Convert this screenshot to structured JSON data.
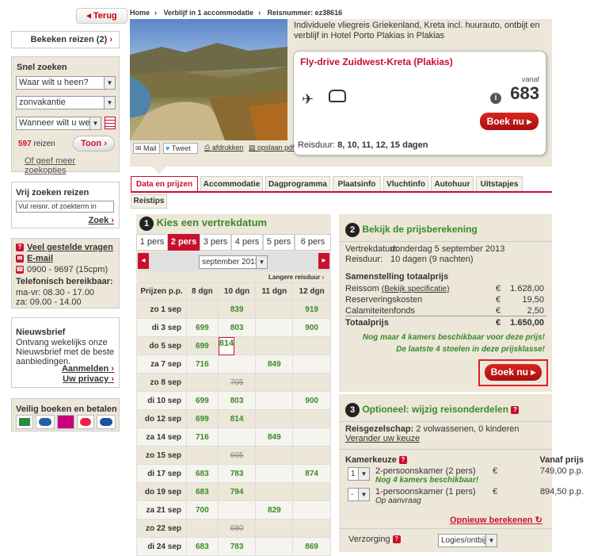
{
  "nav": {
    "back": "Terug"
  },
  "left": {
    "recent": "Bekeken reizen (2)",
    "quick": {
      "title": "Snel zoeken",
      "dest": "Waar wilt u heen?",
      "type": "zonvakantie",
      "when": "Wanneer wilt u weg?",
      "count": "597",
      "count_label": "reizen",
      "show": "Toon",
      "more": "Of geef meer zoekopties"
    },
    "free": {
      "title": "Vrij zoeken reizen",
      "placeholder": "Vul reisnr. of zoekterm in",
      "search": "Zoek"
    },
    "contact": {
      "faq": "Veel gestelde vragen",
      "email": "E-mail",
      "phone": "0900 - 9697 (15cpm)",
      "title": "Telefonisch bereikbaar:",
      "hours1": "ma-vr: 08.30 - 17.00",
      "hours2": "za: 09.00 - 14.00"
    },
    "news": {
      "title": "Nieuwsbrief",
      "text": "Ontvang wekelijks onze Nieuwsbrief met de beste aanbiedingen.",
      "sub": "Aanmelden",
      "privacy": "Uw privacy"
    },
    "safe": {
      "title": "Veilig boeken en betalen"
    }
  },
  "crumb": {
    "home": "Home",
    "stay": "Verblijf in 1 accommodatie",
    "ref": "Reisnummer: ez38616"
  },
  "hero": {
    "desc": "Individuele vliegreis Griekenland, Kreta incl. huurauto, ontbijt en verblijf in Hotel Porto Plakias in Plakias",
    "title": "Fly-drive Zuidwest-Kreta (Plakias)",
    "from": "vanaf",
    "price": "683",
    "book": "Boek nu",
    "dur_label": "Reisduur:",
    "dur": "8, 10, 11, 12, 15 dagen"
  },
  "share": {
    "mail": "Mail",
    "tweet": "Tweet",
    "print": "afdrukken",
    "pdf": "opslaan pdf"
  },
  "tabs": [
    "Data en prijzen",
    "Accommodatie",
    "Dagprogramma",
    "Plaatsinfo",
    "Vluchtinfo",
    "Autohuur",
    "Uitstapjes"
  ],
  "subtab": "Reistips",
  "step1": {
    "num": "1",
    "title": "Kies een vertrekdatum",
    "pers": [
      "1 pers",
      "2 pers",
      "3 pers",
      "4 pers",
      "5 pers",
      "6 pers"
    ],
    "month": "september 2013",
    "longer": "Langere reisduur",
    "headers": [
      "Prijzen p.p.",
      "8 dgn",
      "10 dgn",
      "11 dgn",
      "12 dgn"
    ],
    "rows": [
      [
        "zo 1 sep",
        "",
        "839",
        "",
        "919"
      ],
      [
        "di 3 sep",
        "699",
        "803",
        "",
        "900"
      ],
      [
        "do 5 sep",
        "699",
        "814",
        "",
        ""
      ],
      [
        "za 7 sep",
        "716",
        "",
        "849",
        ""
      ],
      [
        "zo 8 sep",
        "",
        "705",
        "",
        ""
      ],
      [
        "di 10 sep",
        "699",
        "803",
        "",
        "900"
      ],
      [
        "do 12 sep",
        "699",
        "814",
        "",
        ""
      ],
      [
        "za 14 sep",
        "716",
        "",
        "849",
        ""
      ],
      [
        "zo 15 sep",
        "",
        "695",
        "",
        ""
      ],
      [
        "di 17 sep",
        "683",
        "783",
        "",
        "874"
      ],
      [
        "do 19 sep",
        "683",
        "794",
        "",
        ""
      ],
      [
        "za 21 sep",
        "700",
        "",
        "829",
        ""
      ],
      [
        "zo 22 sep",
        "",
        "680",
        "",
        ""
      ],
      [
        "di 24 sep",
        "683",
        "783",
        "",
        "869"
      ]
    ]
  },
  "step2": {
    "num": "2",
    "title": "Bekijk de prijsberekening",
    "dep_l": "Vertrekdatum:",
    "dep": "donderdag 5 september 2013",
    "dur_l": "Reisduur:",
    "dur": "10 dagen (9 nachten)",
    "comp": "Samenstelling totaalprijs",
    "trip": "Reissom",
    "trip_link": "(Bekijk specificatie)",
    "res": "Reserveringskosten",
    "cal": "Calamiteitenfonds",
    "total": "Totaalprijs",
    "cur": "€",
    "v1": "1.628,00",
    "v2": "19,50",
    "v3": "2,50",
    "vt": "1.650,00",
    "msg1": "Nog maar 4 kamers beschikbaar voor deze prijs!",
    "msg2": "De laatste 4 stoelen in deze prijsklasse!",
    "book": "Boek nu"
  },
  "step3": {
    "num": "3",
    "title": "Optioneel: wijzig reisonderdelen",
    "party_l": "Reisgezelschap:",
    "party": "2 volwassenen, 0 kinderen",
    "change": "Verander uw keuze",
    "room_l": "Kamerkeuze",
    "price_l": "Vanaf prijs",
    "r1": "2-persoonskamer (2 pers)",
    "r1n": "1",
    "r1msg": "Nog 4 kamers beschikbaar!",
    "r1p": "749,00 p.p.",
    "r2": "1-persoonskamer (1 pers)",
    "r2n": "-",
    "r2msg": "Op aanvraag",
    "r2p": "894,50 p.p.",
    "cur": "€",
    "recalc": "Opnieuw berekenen",
    "board_l": "Verzorging",
    "board": "Logies/ontbijt"
  }
}
